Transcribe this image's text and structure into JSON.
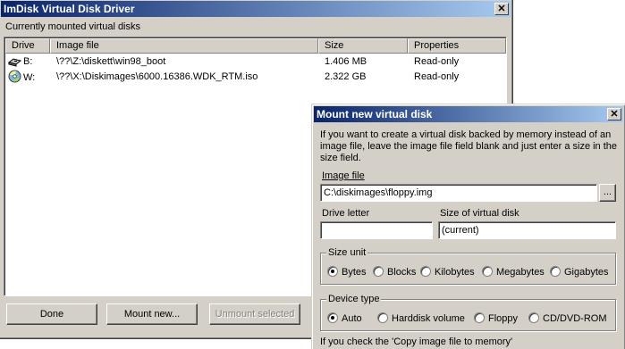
{
  "main_window": {
    "title": "ImDisk Virtual Disk Driver",
    "close_glyph": "✕",
    "section_label": "Currently mounted virtual disks",
    "columns": [
      "Drive",
      "Image file",
      "Size",
      "Properties"
    ],
    "rows": [
      {
        "drive": "B:",
        "icon": "floppy-drive-icon",
        "image_file": "\\??\\Z:\\diskett\\win98_boot",
        "size": "1.406 MB",
        "properties": "Read-only"
      },
      {
        "drive": "W:",
        "icon": "cd-drive-icon",
        "image_file": "\\??\\X:\\Diskimages\\6000.16386.WDK_RTM.iso",
        "size": "2.322 GB",
        "properties": "Read-only"
      }
    ],
    "buttons": {
      "done": "Done",
      "mount_new": "Mount new...",
      "unmount_selected": "Unmount selected"
    }
  },
  "dialog": {
    "title": "Mount new virtual disk",
    "close_glyph": "✕",
    "intro_line1": "If you want to create a virtual disk backed by memory instead of an",
    "intro_line2": "image file, leave the image file field blank and just enter a size in the",
    "intro_line3": "size field.",
    "image_file_label": "Image file",
    "image_file_value": "C:\\diskimages\\floppy.img",
    "browse_label": "...",
    "drive_letter_label": "Drive letter",
    "drive_letter_value": "",
    "size_label": "Size of virtual disk",
    "size_value": "(current)",
    "size_unit": {
      "title": "Size unit",
      "options": [
        "Bytes",
        "Blocks",
        "Kilobytes",
        "Megabytes",
        "Gigabytes"
      ],
      "selected": "Bytes"
    },
    "device_type": {
      "title": "Device type",
      "options": [
        "Auto",
        "Harddisk volume",
        "Floppy",
        "CD/DVD-ROM"
      ],
      "selected": "Auto"
    },
    "footer_text": "If you check the 'Copy image file to memory'"
  }
}
